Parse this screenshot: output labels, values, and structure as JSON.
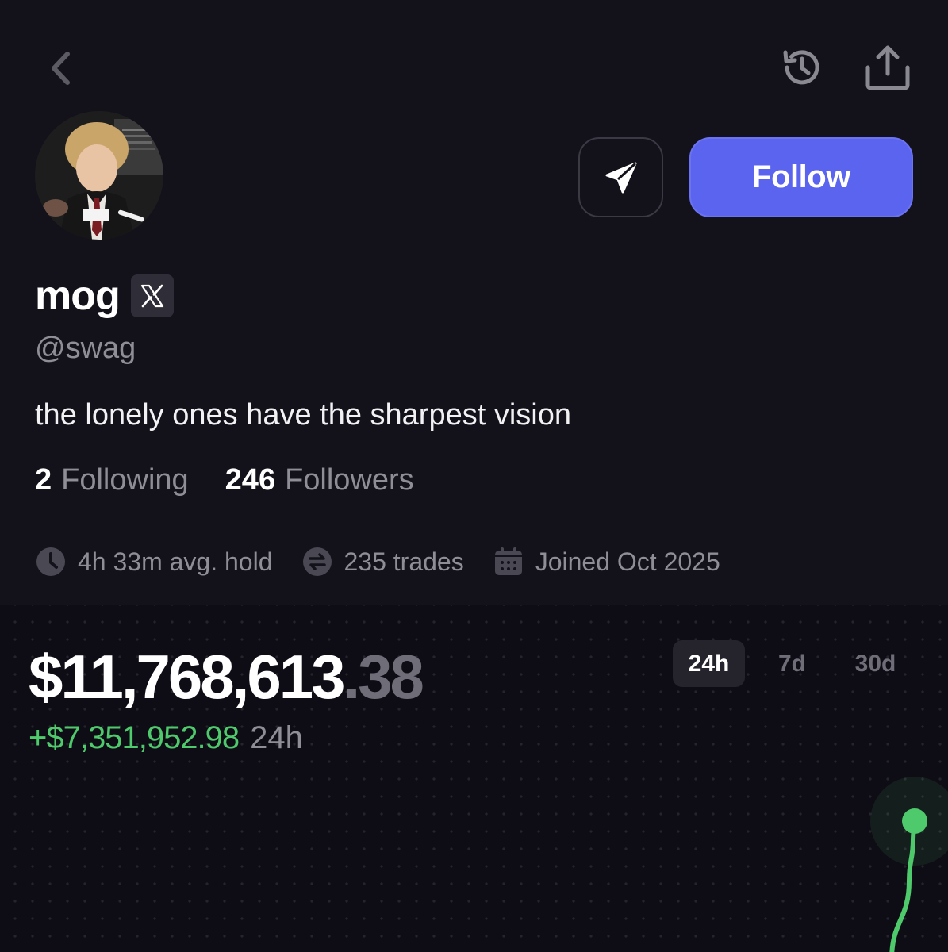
{
  "header": {
    "back_icon": "chevron-left-icon",
    "history_icon": "history-icon",
    "share_icon": "share-icon"
  },
  "profile": {
    "display_name": "mog",
    "handle": "@swag",
    "bio": "the lonely ones have the sharpest vision",
    "following_count": "2",
    "following_label": "Following",
    "followers_count": "246",
    "followers_label": "Followers",
    "follow_label": "Follow",
    "badge_icon": "x-logo-icon"
  },
  "stats": {
    "avg_hold": "4h 33m avg. hold",
    "trades": "235 trades",
    "joined": "Joined Oct 2025"
  },
  "portfolio": {
    "balance_main": "$11,768,613",
    "balance_cents": ".38",
    "change_value": "+$7,351,952.98",
    "change_period": "24h",
    "ranges": [
      "24h",
      "7d",
      "30d"
    ],
    "active_range": "24h"
  },
  "colors": {
    "background": "#13121b",
    "accent": "#5b64ee",
    "positive": "#4ec96b",
    "muted": "#8f8e96"
  },
  "chart_data": {
    "type": "line",
    "series": [
      {
        "values": [
          0.78,
          0.9,
          0.97,
          1.0
        ]
      }
    ]
  }
}
